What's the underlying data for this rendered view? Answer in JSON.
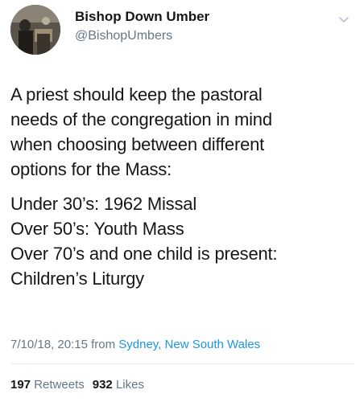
{
  "author": {
    "display_name": "Bishop Down Umber",
    "handle": "@BishopUmbers"
  },
  "tweet": {
    "paragraphs": [
      {
        "lines": [
          "A priest should keep the pastoral",
          "needs of the congregation in mind",
          "when choosing between different",
          "options for the Mass:"
        ]
      },
      {
        "lines": [
          "Under 30’s: 1962 Missal",
          "Over 50’s: Youth Mass",
          "Over 70’s and one child is present:",
          "Children’s Liturgy"
        ]
      }
    ],
    "timestamp": "7/10/18, 20:15",
    "from_label": "from",
    "location": "Sydney, New South Wales"
  },
  "stats": {
    "retweets_count": "197",
    "retweets_label": "Retweets",
    "likes_count": "932",
    "likes_label": "Likes"
  },
  "icons": {
    "menu": "chevron-down-icon",
    "avatar": "avatar"
  },
  "colors": {
    "text": "#14171a",
    "secondary": "#657786",
    "link": "#1b95e0",
    "divider": "#e6ecf0"
  }
}
